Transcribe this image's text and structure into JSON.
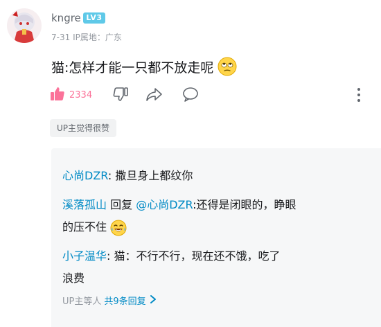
{
  "comment": {
    "username": "kngre",
    "level": "LV3",
    "date": "7-31",
    "ip_location": "IP属地：广东",
    "text": "猫:怎样才能一只都不放走呢",
    "emoji": "eye-roll-emoji",
    "like_count": "2334",
    "up_liked": "UP主觉得很赞"
  },
  "replies": [
    {
      "user": "心尚DZR",
      "sep": ": ",
      "text": "撒旦身上都纹你"
    },
    {
      "user": "溪落孤山",
      "sep": " 回复 ",
      "mention": "@心尚DZR",
      "text_line1": ":还得是闭眼的，睁眼",
      "text_line2": "的压不住",
      "emoji": "laughing-tears-emoji"
    },
    {
      "user": "小子温华",
      "sep": ": ",
      "text_line1": "猫：不行不行，现在还不饿，吃了",
      "text_line2": "浪费"
    }
  ],
  "replies_footer": {
    "up_label": "UP主等人",
    "count_label": "共9条回复"
  },
  "colors": {
    "accent_pink": "#fb7299",
    "link_blue": "#008ac5",
    "level_badge": "#5fc9e8",
    "muted": "#9499a0"
  }
}
